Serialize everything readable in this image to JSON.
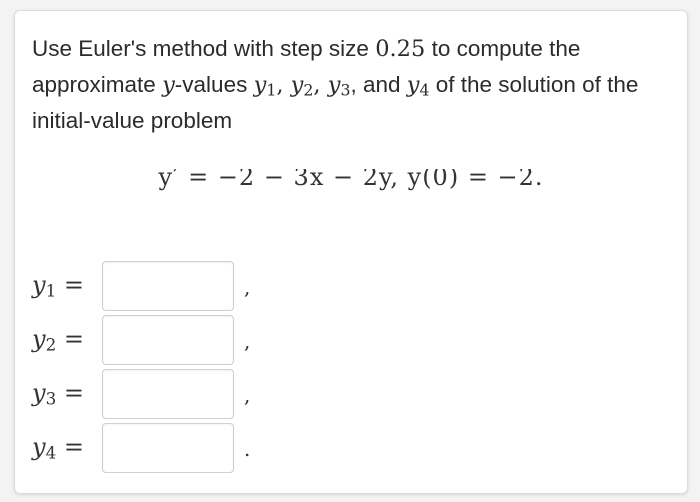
{
  "prompt": {
    "text_before_step": "Use Euler's method with step size ",
    "step": "0.25",
    "text_after_step": " to compute the approximate ",
    "y_var": "y",
    "text_values": "-values ",
    "y1_sym": "y",
    "y1_sub": "1",
    "sep1": ", ",
    "y2_sym": "y",
    "y2_sub": "2",
    "sep2": ", ",
    "y3_sym": "y",
    "y3_sub": "3",
    "text_and": ", and ",
    "y4_sym": "y",
    "y4_sub": "4",
    "text_end": " of the solution of the initial-value problem"
  },
  "equation": {
    "display": "y′ = −2 − 3x − 2y,    y(0) = −2."
  },
  "answers": [
    {
      "sym": "y",
      "sub": "1",
      "eq": " =",
      "value": "",
      "punct": ","
    },
    {
      "sym": "y",
      "sub": "2",
      "eq": " =",
      "value": "",
      "punct": ","
    },
    {
      "sym": "y",
      "sub": "3",
      "eq": " =",
      "value": "",
      "punct": ","
    },
    {
      "sym": "y",
      "sub": "4",
      "eq": " =",
      "value": "",
      "punct": "."
    }
  ]
}
